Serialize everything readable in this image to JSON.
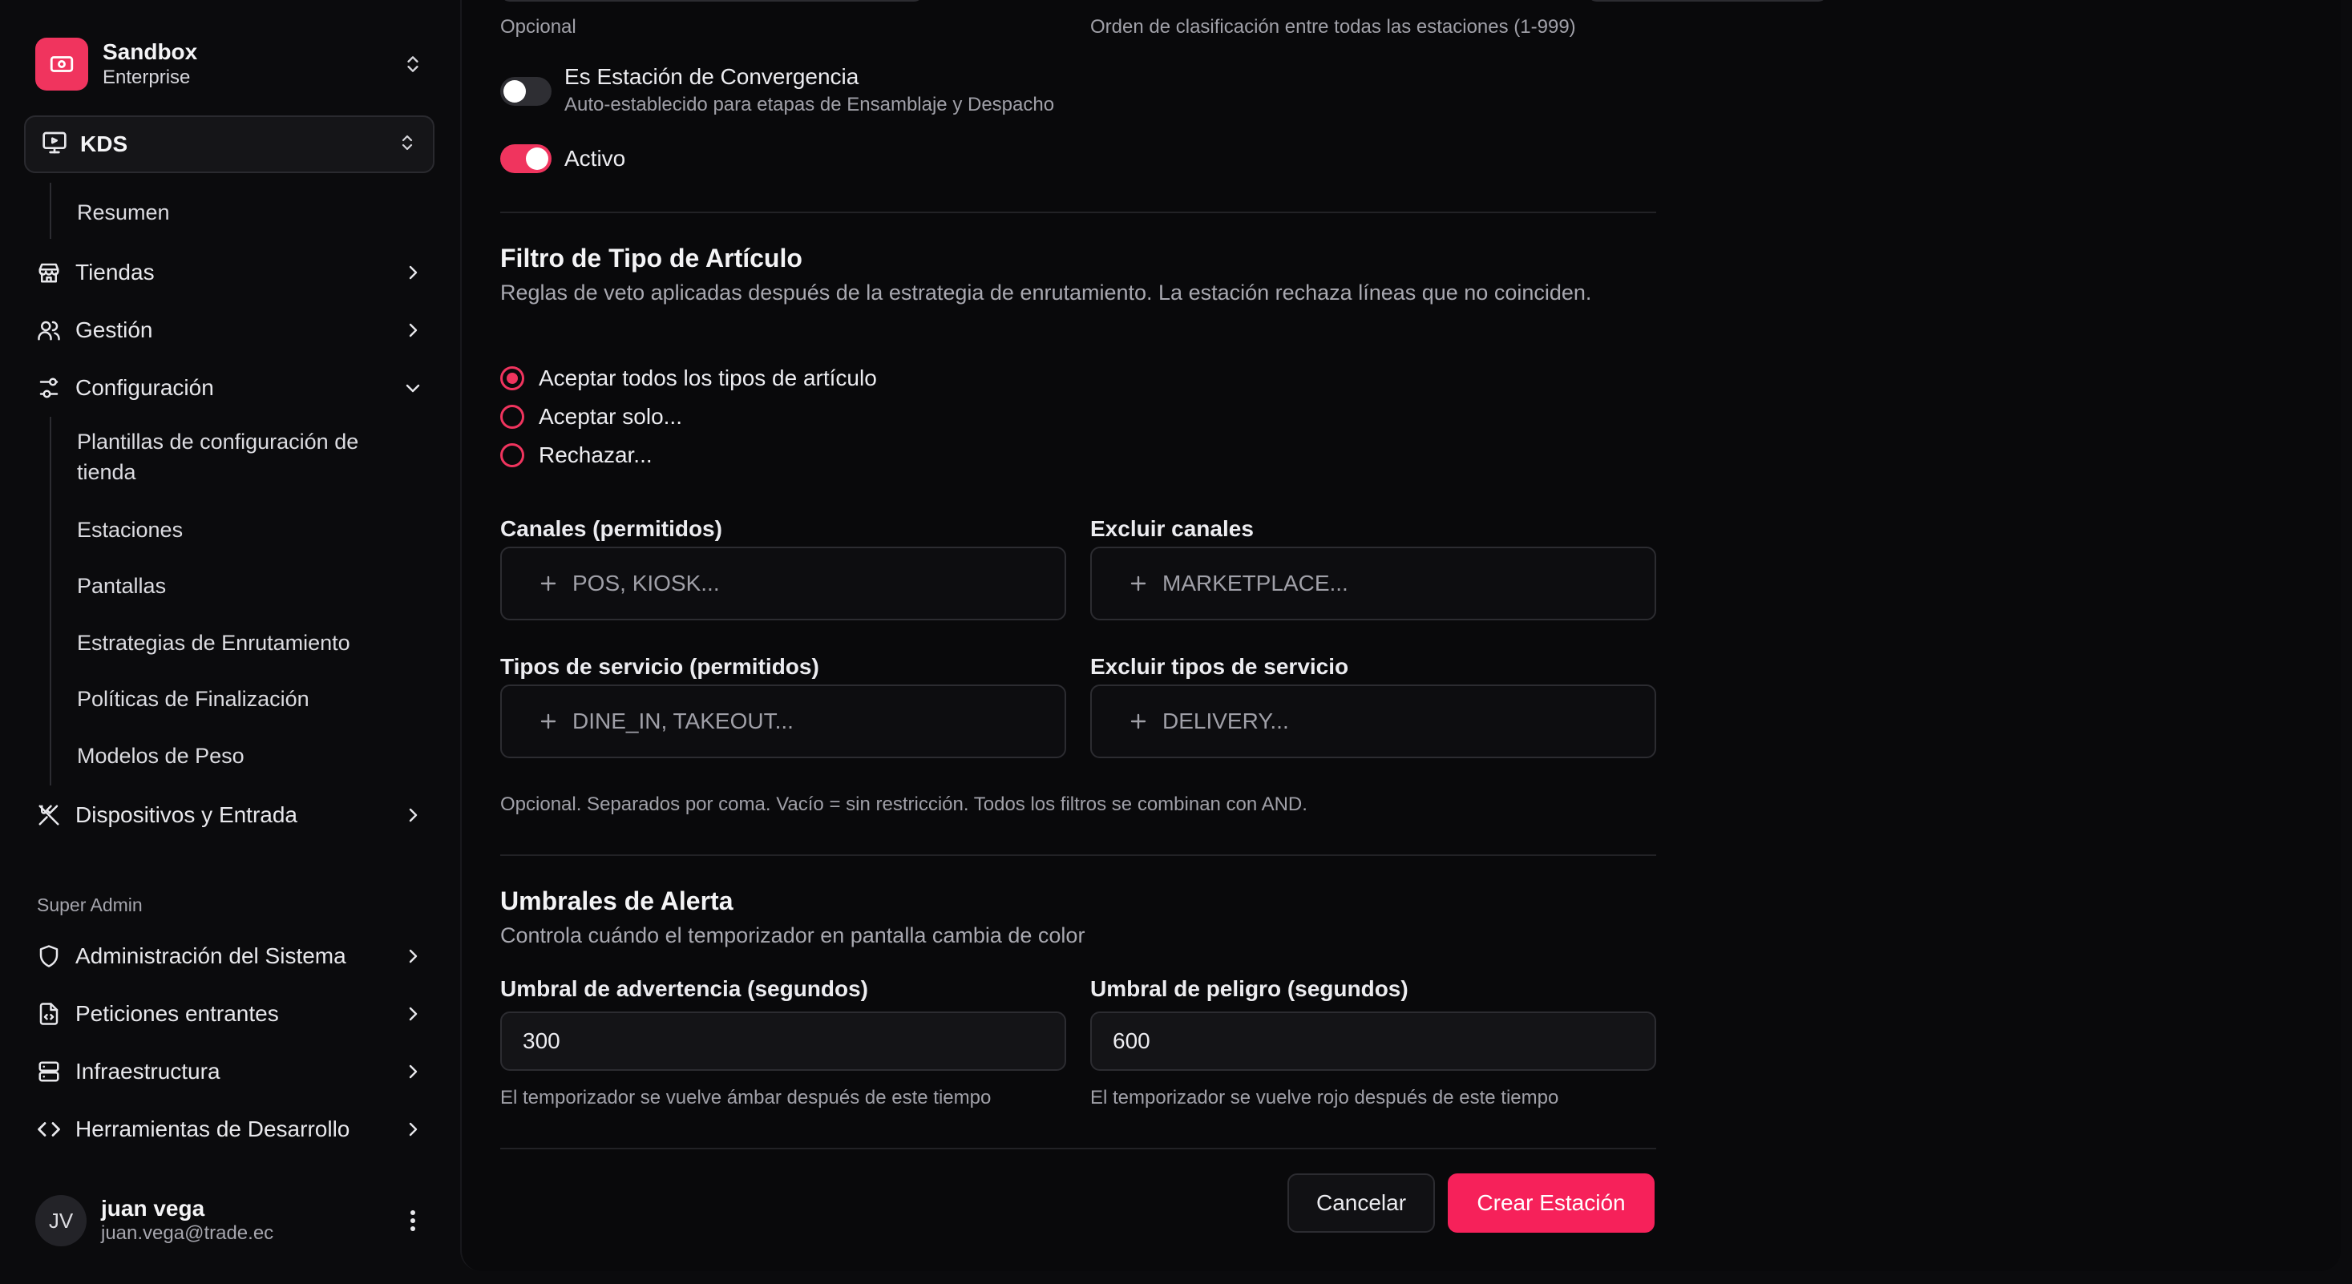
{
  "org": {
    "name": "Sandbox",
    "plan": "Enterprise"
  },
  "app_select": {
    "label": "KDS"
  },
  "nav": {
    "kds_sub": [
      "Resumen"
    ],
    "tiendas": "Tiendas",
    "gestion": "Gestión",
    "configuracion": "Configuración",
    "config_sub": [
      "Plantillas de configuración de tienda",
      "Estaciones",
      "Pantallas",
      "Estrategias de Enrutamiento",
      "Políticas de Finalización",
      "Modelos de Peso"
    ],
    "dispositivos": "Dispositivos y Entrada",
    "super_admin_label": "Super Admin",
    "admin_sistema": "Administración del Sistema",
    "peticiones": "Peticiones entrantes",
    "infraestructura": "Infraestructura",
    "herramientas": "Herramientas de Desarrollo"
  },
  "user": {
    "initials": "JV",
    "name": "juan vega",
    "email": "juan.vega@trade.ec"
  },
  "form": {
    "top_hint_left": "Opcional",
    "top_hint_right": "Orden de clasificación entre todas las estaciones (1-999)",
    "convergence": {
      "label": "Es Estación de Convergencia",
      "hint": "Auto-establecido para etapas de Ensamblaje y Despacho",
      "on": false
    },
    "active": {
      "label": "Activo",
      "on": true
    },
    "item_filter": {
      "title": "Filtro de Tipo de Artículo",
      "description": "Reglas de veto aplicadas después de la estrategia de enrutamiento. La estación rechaza líneas que no coinciden.",
      "options": [
        "Aceptar todos los tipos de artículo",
        "Aceptar solo...",
        "Rechazar..."
      ],
      "selected_index": 0
    },
    "channels_allowed": {
      "label": "Canales (permitidos)",
      "placeholder": "POS, KIOSK..."
    },
    "channels_excluded": {
      "label": "Excluir canales",
      "placeholder": "MARKETPLACE..."
    },
    "service_allowed": {
      "label": "Tipos de servicio (permitidos)",
      "placeholder": "DINE_IN, TAKEOUT..."
    },
    "service_excluded": {
      "label": "Excluir tipos de servicio",
      "placeholder": "DELIVERY..."
    },
    "filters_hint": "Opcional. Separados por coma. Vacío = sin restricción. Todos los filtros se combinan con AND.",
    "alerts": {
      "title": "Umbrales de Alerta",
      "description": "Controla cuándo el temporizador en pantalla cambia de color",
      "warning_label": "Umbral de advertencia (segundos)",
      "warning_value": "300",
      "warning_hint": "El temporizador se vuelve ámbar después de este tiempo",
      "danger_label": "Umbral de peligro (segundos)",
      "danger_value": "600",
      "danger_hint": "El temporizador se vuelve rojo después de este tiempo"
    },
    "cancel_label": "Cancelar",
    "submit_label": "Crear Estación"
  },
  "colors": {
    "accent": "#f0345e",
    "background": "#0b0b0d"
  }
}
